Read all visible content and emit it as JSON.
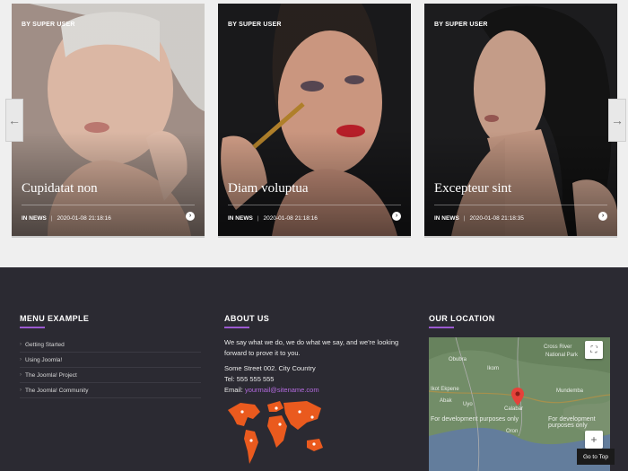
{
  "carousel": {
    "prev_icon": "arrow-left-icon",
    "next_icon": "arrow-right-icon",
    "prev_glyph": "←",
    "next_glyph": "→",
    "cards": [
      {
        "author": "BY SUPER USER",
        "title": "Cupidatat non",
        "category": "IN NEWS",
        "date": "2020-01-08 21:18:16",
        "more_glyph": "›"
      },
      {
        "author": "BY SUPER USER",
        "title": "Diam voluptua",
        "category": "IN NEWS",
        "date": "2020-01-08 21:18:16",
        "more_glyph": "›"
      },
      {
        "author": "BY SUPER USER",
        "title": "Excepteur sint",
        "category": "IN NEWS",
        "date": "2020-01-08 21:18:35",
        "more_glyph": "›"
      }
    ]
  },
  "footer": {
    "menu": {
      "title": "MENU EXAMPLE",
      "items": [
        "Getting Started",
        "Using Joomla!",
        "The Joomla! Project",
        "The Joomla! Community"
      ]
    },
    "about": {
      "title": "ABOUT US",
      "text": "We say what we do, we do what we say, and we're looking forward to prove it to you.",
      "address": "Some Street 002. City Country",
      "tel": "Tel: 555 555 555",
      "email_label": "Email:",
      "email": "yourmail@sitename.com"
    },
    "location": {
      "title": "OUR LOCATION",
      "dev_text": "For development purposes only",
      "labels": [
        "Cross River",
        "National Park",
        "Ikom",
        "Obubra",
        "Ikot Ekpene",
        "Uyo",
        "Abak",
        "Calabar",
        "Mundemba",
        "Oron"
      ]
    },
    "go_to_top": "Go to Top"
  },
  "colors": {
    "accent": "#9b59d0",
    "footer_bg": "#2b2a32",
    "map_marker": "#e5413a"
  }
}
